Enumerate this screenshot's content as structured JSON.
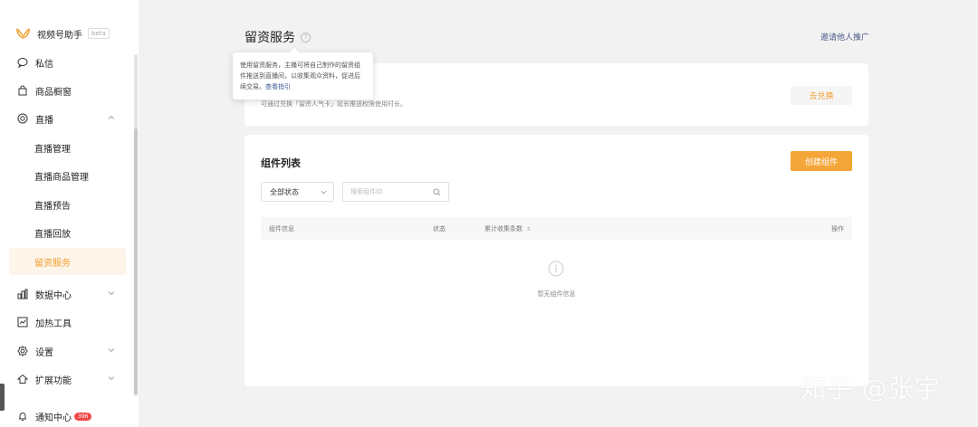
{
  "app": {
    "name": "视频号助手",
    "beta": "beta"
  },
  "sidebar": {
    "items": [
      {
        "label": "私信",
        "icon": "chat-bubble-icon"
      },
      {
        "label": "商品橱窗",
        "icon": "shopping-bag-icon"
      },
      {
        "label": "直播",
        "icon": "live-circle-icon",
        "expanded": true
      },
      {
        "label": "直播管理"
      },
      {
        "label": "直播商品管理"
      },
      {
        "label": "直播预告"
      },
      {
        "label": "直播回放"
      },
      {
        "label": "留资服务",
        "active": true
      },
      {
        "label": "数据中心",
        "icon": "bar-chart-icon"
      },
      {
        "label": "加热工具",
        "icon": "trend-chart-icon"
      },
      {
        "label": "设置",
        "icon": "gear-icon"
      },
      {
        "label": "扩展功能",
        "icon": "extension-icon"
      },
      {
        "label": "通知中心",
        "icon": "bell-icon",
        "badge": "396"
      }
    ]
  },
  "header": {
    "title": "留资服务",
    "invite_link": "邀请他人推广"
  },
  "tooltip": {
    "text": "使用留资服务，主播可将自己制作的留资组件推送到直播间，以收集观众资料，促进后续交易。",
    "link": "查看指引"
  },
  "top_card": {
    "description": "可通过兑换「留资人气卡」延长推送权限使用时长。",
    "exchange_button": "去兑换"
  },
  "component_list": {
    "title": "组件列表",
    "create_button": "创建组件",
    "status_filter": "全部状态",
    "search_placeholder": "搜索组件ID",
    "columns": {
      "info": "组件信息",
      "status": "状态",
      "total": "累计收集条数",
      "actions": "操作"
    },
    "empty_text": "暂无组件信息"
  },
  "watermark": "知乎 @张宇",
  "colors": {
    "accent": "#f5a638",
    "active_bg": "#fdf4ea",
    "badge": "#f04848",
    "link": "#4a5b8a"
  }
}
